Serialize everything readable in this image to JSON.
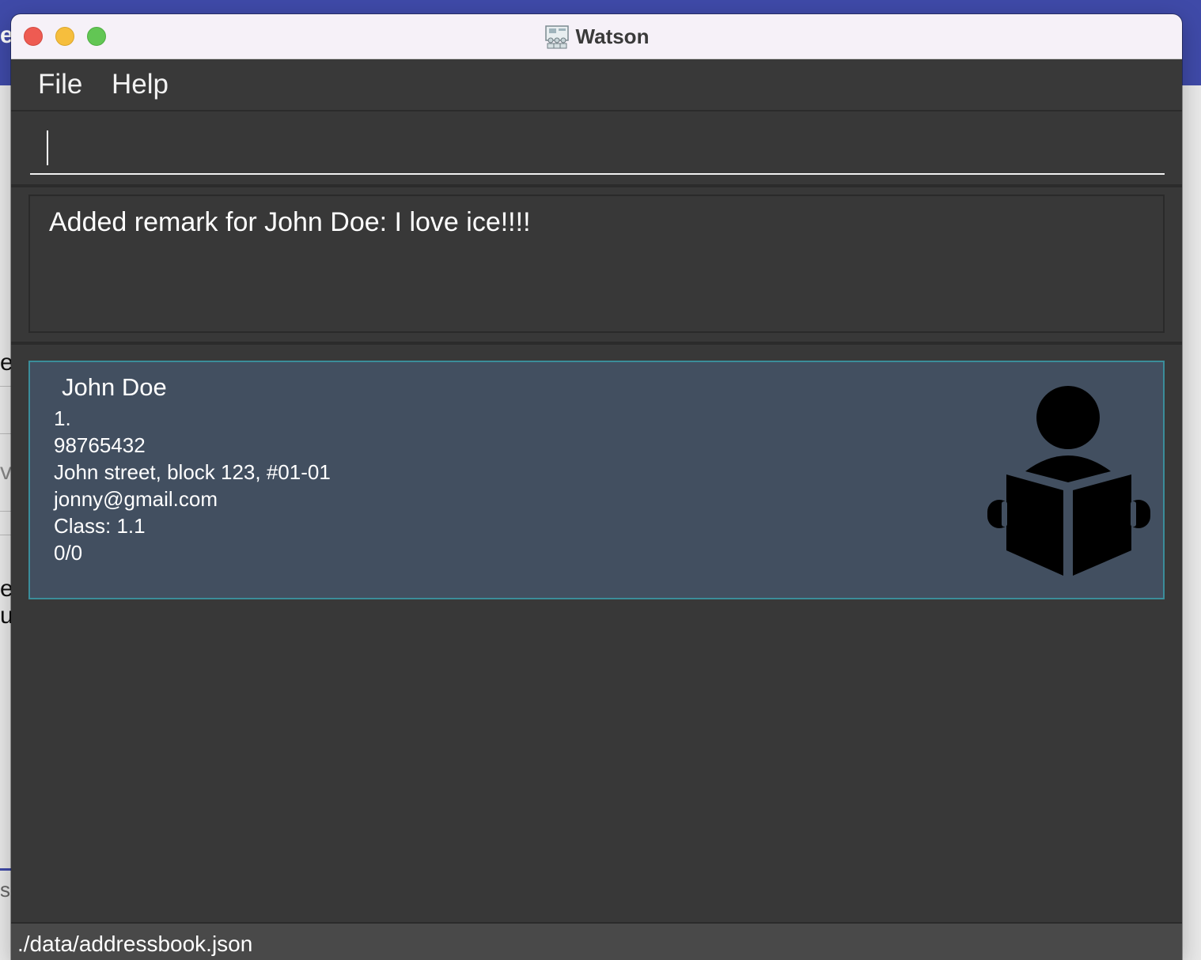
{
  "window": {
    "title": "Watson",
    "app_icon": "watson-app-icon"
  },
  "menu": {
    "items": [
      {
        "label": "File"
      },
      {
        "label": "Help"
      }
    ]
  },
  "command_box": {
    "value": "",
    "placeholder": ""
  },
  "result_display": {
    "text": "Added remark for John Doe: I love ice!!!!"
  },
  "person_list": {
    "persons": [
      {
        "name": "John Doe",
        "index": "1.",
        "phone": "98765432",
        "address": "John street, block 123, #01-01",
        "email": "jonny@gmail.com",
        "student_class": "Class: 1.1",
        "attendance": "0/0",
        "icon": "student-reading-icon"
      }
    ]
  },
  "status_bar": {
    "file_path": "./data/addressbook.json"
  },
  "background_fragments": [
    "e",
    "er",
    "vi",
    "e",
    "u",
    "s"
  ],
  "colors": {
    "card_background": "#424f60",
    "card_border": "#3b8d9a",
    "panel_background": "#383838",
    "titlebar_background": "#f6f1f8"
  }
}
